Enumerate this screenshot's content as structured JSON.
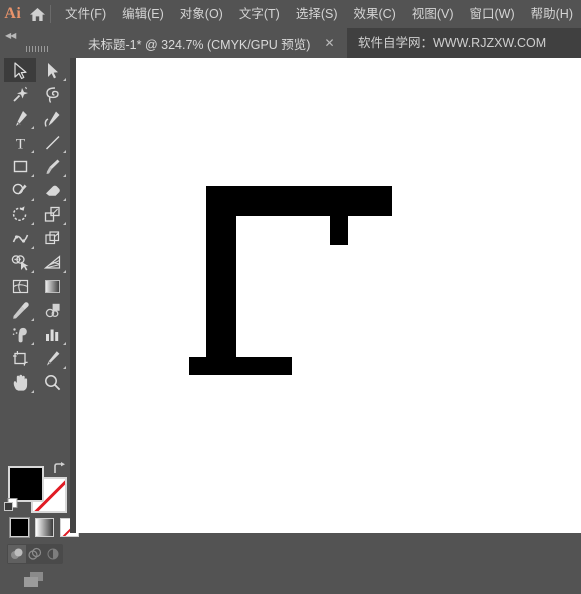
{
  "app": {
    "logo_text": "Ai",
    "home_icon": "home-icon"
  },
  "menu": {
    "items": [
      {
        "label": "文件(F)",
        "name": "menu-file"
      },
      {
        "label": "编辑(E)",
        "name": "menu-edit"
      },
      {
        "label": "对象(O)",
        "name": "menu-object"
      },
      {
        "label": "文字(T)",
        "name": "menu-type"
      },
      {
        "label": "选择(S)",
        "name": "menu-select"
      },
      {
        "label": "效果(C)",
        "name": "menu-effect"
      },
      {
        "label": "视图(V)",
        "name": "menu-view"
      },
      {
        "label": "窗口(W)",
        "name": "menu-window"
      },
      {
        "label": "帮助(H)",
        "name": "menu-help"
      }
    ]
  },
  "tabbar": {
    "collapse_arrows": "◀◀",
    "document_tab": {
      "title": "未标题-1* @ 324.7% (CMYK/GPU 预览)",
      "close_label": "✕",
      "document_name": "未标题-1*",
      "modified": true,
      "zoom": "324.7%",
      "color_mode": "CMYK",
      "renderer": "GPU 预览"
    },
    "watermark": "软件自学网：WWW.RJZXW.COM"
  },
  "toolbar": {
    "tools": [
      [
        {
          "name": "selection-tool",
          "tooltip": "选择工具",
          "selected": true,
          "has_flyout": false
        },
        {
          "name": "direct-selection-tool",
          "tooltip": "直接选择工具",
          "selected": false,
          "has_flyout": true
        }
      ],
      [
        {
          "name": "magic-wand-tool",
          "tooltip": "魔棒工具",
          "selected": false,
          "has_flyout": false
        },
        {
          "name": "lasso-tool",
          "tooltip": "套索工具",
          "selected": false,
          "has_flyout": false
        }
      ],
      [
        {
          "name": "pen-tool",
          "tooltip": "钢笔工具",
          "selected": false,
          "has_flyout": true
        },
        {
          "name": "curvature-tool",
          "tooltip": "曲率工具",
          "selected": false,
          "has_flyout": false
        }
      ],
      [
        {
          "name": "type-tool",
          "tooltip": "文字工具",
          "selected": false,
          "has_flyout": true
        },
        {
          "name": "line-segment-tool",
          "tooltip": "直线段工具",
          "selected": false,
          "has_flyout": true
        }
      ],
      [
        {
          "name": "rectangle-tool",
          "tooltip": "矩形工具",
          "selected": false,
          "has_flyout": true
        },
        {
          "name": "paintbrush-tool",
          "tooltip": "画笔工具",
          "selected": false,
          "has_flyout": true
        }
      ],
      [
        {
          "name": "shaper-pencil-tool",
          "tooltip": "Shaper 工具",
          "selected": false,
          "has_flyout": true
        },
        {
          "name": "eraser-tool",
          "tooltip": "橡皮擦工具",
          "selected": false,
          "has_flyout": true
        }
      ],
      [
        {
          "name": "rotate-tool",
          "tooltip": "旋转工具",
          "selected": false,
          "has_flyout": true
        },
        {
          "name": "scale-tool",
          "tooltip": "比例缩放工具",
          "selected": false,
          "has_flyout": true
        }
      ],
      [
        {
          "name": "width-warp-tool",
          "tooltip": "宽度工具",
          "selected": false,
          "has_flyout": true
        },
        {
          "name": "free-transform-tool",
          "tooltip": "自由变换工具",
          "selected": false,
          "has_flyout": false
        }
      ],
      [
        {
          "name": "shape-builder-tool",
          "tooltip": "形状生成器工具",
          "selected": false,
          "has_flyout": true
        },
        {
          "name": "perspective-grid-tool",
          "tooltip": "透视网格工具",
          "selected": false,
          "has_flyout": true
        }
      ],
      [
        {
          "name": "mesh-tool",
          "tooltip": "网格工具",
          "selected": false,
          "has_flyout": false
        },
        {
          "name": "gradient-tool",
          "tooltip": "渐变工具",
          "selected": false,
          "has_flyout": false
        }
      ],
      [
        {
          "name": "eyedropper-tool",
          "tooltip": "吸管工具",
          "selected": false,
          "has_flyout": true
        },
        {
          "name": "blend-tool",
          "tooltip": "混合工具",
          "selected": false,
          "has_flyout": false
        }
      ],
      [
        {
          "name": "symbol-sprayer-tool",
          "tooltip": "符号喷枪工具",
          "selected": false,
          "has_flyout": true
        },
        {
          "name": "column-graph-tool",
          "tooltip": "柱形图工具",
          "selected": false,
          "has_flyout": true
        }
      ],
      [
        {
          "name": "artboard-tool",
          "tooltip": "画板工具",
          "selected": false,
          "has_flyout": false
        },
        {
          "name": "slice-tool",
          "tooltip": "切片工具",
          "selected": false,
          "has_flyout": true
        }
      ],
      [
        {
          "name": "hand-tool",
          "tooltip": "抓手工具",
          "selected": false,
          "has_flyout": true
        },
        {
          "name": "zoom-tool",
          "tooltip": "缩放工具",
          "selected": false,
          "has_flyout": false
        }
      ]
    ],
    "fill_color": "#000000",
    "stroke_color": "#ffffff",
    "stroke_is_none": true,
    "swap_icon": "swap-fill-stroke-icon",
    "default_colors_icon": "default-fill-stroke-icon",
    "paint_modes": [
      {
        "name": "color-mode-button",
        "type": "color"
      },
      {
        "name": "gradient-mode-button",
        "type": "gradient"
      },
      {
        "name": "none-mode-button",
        "type": "none"
      }
    ],
    "draw_modes": [
      {
        "name": "draw-normal-button",
        "active": true
      },
      {
        "name": "draw-behind-button",
        "active": false
      },
      {
        "name": "draw-inside-button",
        "active": false
      }
    ],
    "screen_mode": {
      "name": "change-screen-mode-button"
    }
  },
  "canvas": {
    "background": "#ffffff",
    "artwork_color": "#000000",
    "artwork_name": "cjk-stroke-path",
    "artwork_description": "黑色折笔画路径（横折＋竖＋横挑）"
  },
  "colors": {
    "chrome_bg": "#535353",
    "tab_bg": "#404040",
    "text": "#d4d4d4",
    "logo": "#e8936b",
    "canvas": "#ffffff",
    "ink": "#000000",
    "accent_red": "#e01b24"
  }
}
